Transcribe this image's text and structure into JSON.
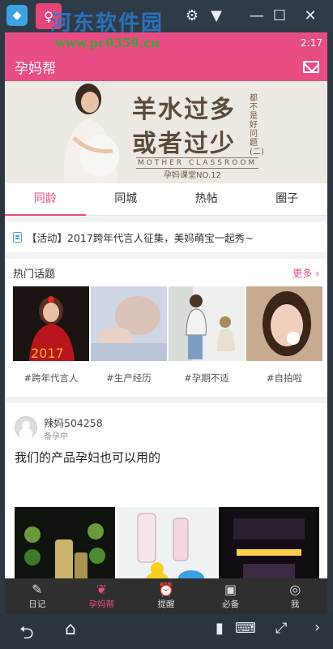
{
  "watermark": {
    "text": "河东软件园",
    "url": "www.pc0359.cn"
  },
  "statusbar": {
    "time": "2:17"
  },
  "appbar": {
    "title": "孕妈帮"
  },
  "banner": {
    "line1": "羊水过多",
    "line2": "或者过少",
    "side_text": "都不是好问题(二)",
    "english": "MOTHER CLASSROOM",
    "issue": "孕妈课堂NO.12"
  },
  "tabs": [
    {
      "label": "同龄",
      "active": true
    },
    {
      "label": "同城",
      "active": false
    },
    {
      "label": "热帖",
      "active": false
    },
    {
      "label": "圈子",
      "active": false
    }
  ],
  "notice": {
    "text": "【活动】2017跨年代言人征集，美妈萌宝一起秀~"
  },
  "topics": {
    "title": "热门话题",
    "more": "更多 ›",
    "items": [
      {
        "label": "#跨年代言人",
        "caption": "2017"
      },
      {
        "label": "#生产经历"
      },
      {
        "label": "#孕期不适"
      },
      {
        "label": "#自拍啦"
      }
    ]
  },
  "post": {
    "user": "辣妈504258",
    "stage": "备孕中",
    "text": "我们的产品孕妇也可以用的"
  },
  "bottomnav": [
    {
      "label": "日记",
      "icon": "pencil-icon",
      "active": false
    },
    {
      "label": "孕妈帮",
      "icon": "chat-icon",
      "active": true
    },
    {
      "label": "提醒",
      "icon": "alarm-icon",
      "active": false
    },
    {
      "label": "必备",
      "icon": "briefcase-icon",
      "active": false
    },
    {
      "label": "我",
      "icon": "user-icon",
      "active": false
    }
  ],
  "colors": {
    "accent": "#e74d84",
    "nav_bg": "#2f2f2f"
  }
}
